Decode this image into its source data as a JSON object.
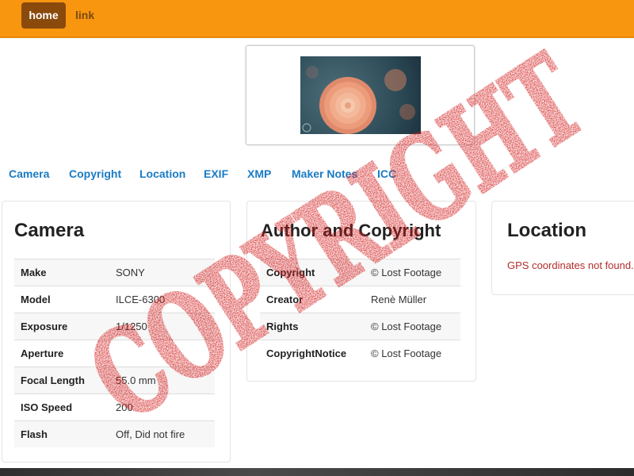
{
  "nav": {
    "home": "home",
    "link": "link"
  },
  "tabs": [
    "Camera",
    "Copyright",
    "Location",
    "EXIF",
    "XMP",
    "Maker Notes",
    "ICC"
  ],
  "camera": {
    "title": "Camera",
    "rows": [
      {
        "key": "Make",
        "value": "SONY"
      },
      {
        "key": "Model",
        "value": "ILCE-6300"
      },
      {
        "key": "Exposure",
        "value": "1/1250"
      },
      {
        "key": "Aperture",
        "value": ""
      },
      {
        "key": "Focal Length",
        "value": "55.0 mm"
      },
      {
        "key": "ISO Speed",
        "value": "200"
      },
      {
        "key": "Flash",
        "value": "Off, Did not fire"
      }
    ]
  },
  "copyright": {
    "title": "Author and Copyright",
    "rows": [
      {
        "key": "Copyright",
        "value": "© Lost Footage"
      },
      {
        "key": "Creator",
        "value": "Renè Müller"
      },
      {
        "key": "Rights",
        "value": "© Lost Footage"
      },
      {
        "key": "CopyrightNotice",
        "value": "© Lost Footage"
      }
    ]
  },
  "location": {
    "title": "Location",
    "message": "GPS coordinates not found."
  },
  "stamp": {
    "text": "COPYRIGHT",
    "color": "#d42020"
  },
  "colors": {
    "topbar": "#f8960f",
    "home_button": "#8a4a0c",
    "tab_link": "#1a7bc4",
    "error_text": "#b52c2c"
  }
}
